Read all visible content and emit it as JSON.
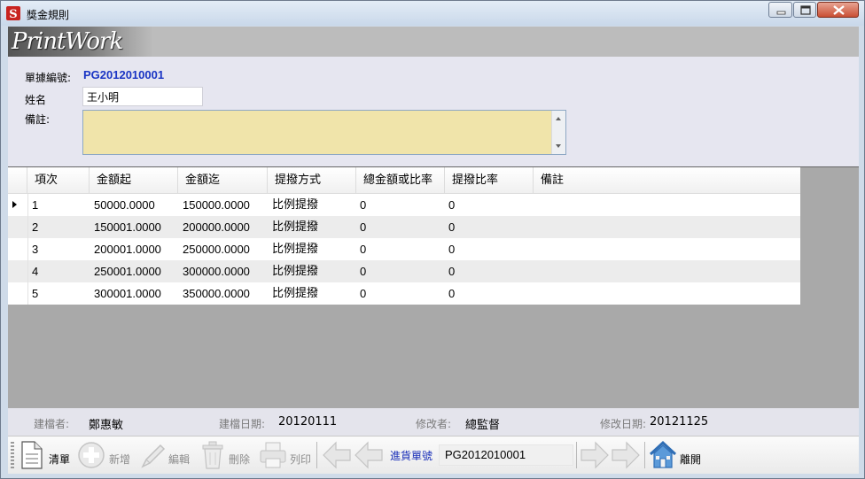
{
  "window": {
    "title": "獎金規則"
  },
  "banner": {
    "logo_text": "PrintWork"
  },
  "form": {
    "doc_no_label": "單據編號:",
    "doc_no_value": "PG2012010001",
    "name_label": "姓名",
    "name_value": "王小明",
    "remark_label": "備註:",
    "remark_value": ""
  },
  "grid": {
    "columns": [
      "項次",
      "金額起",
      "金額迄",
      "提撥方式",
      "總金額或比率",
      "提撥比率",
      "備註"
    ],
    "rows": [
      {
        "item": "1",
        "from": "50000.0000",
        "to": "150000.0000",
        "method": "比例提撥",
        "total_or_ratio": "0",
        "ratio": "0",
        "remark": "",
        "current": true
      },
      {
        "item": "2",
        "from": "150001.0000",
        "to": "200000.0000",
        "method": "比例提撥",
        "total_or_ratio": "0",
        "ratio": "0",
        "remark": "",
        "current": false
      },
      {
        "item": "3",
        "from": "200001.0000",
        "to": "250000.0000",
        "method": "比例提撥",
        "total_or_ratio": "0",
        "ratio": "0",
        "remark": "",
        "current": false
      },
      {
        "item": "4",
        "from": "250001.0000",
        "to": "300000.0000",
        "method": "比例提撥",
        "total_or_ratio": "0",
        "ratio": "0",
        "remark": "",
        "current": false
      },
      {
        "item": "5",
        "from": "300001.0000",
        "to": "350000.0000",
        "method": "比例提撥",
        "total_or_ratio": "0",
        "ratio": "0",
        "remark": "",
        "current": false
      }
    ]
  },
  "footer": {
    "creator_label": "建檔者:",
    "creator_value": "鄭惠敏",
    "created_date_label": "建檔日期:",
    "created_date_value": "20120111",
    "modifier_label": "修改者:",
    "modifier_value": "總監督",
    "modified_date_label": "修改日期:",
    "modified_date_value": "20121125"
  },
  "toolbar": {
    "clear_label": "清單",
    "add_label": "新增",
    "edit_label": "編輯",
    "delete_label": "刪除",
    "print_label": "列印",
    "goto_label": "進貨單號",
    "docno_value": "PG2012010001",
    "exit_label": "離開"
  },
  "colors": {
    "window_frame": "#cfdbe9",
    "form_bg": "#e6e6f0",
    "doc_no_text": "#1a35c4",
    "remark_bg": "#f0e4aa",
    "grid_area_bg": "#a9a9a9",
    "close_button": "#c94f34"
  }
}
